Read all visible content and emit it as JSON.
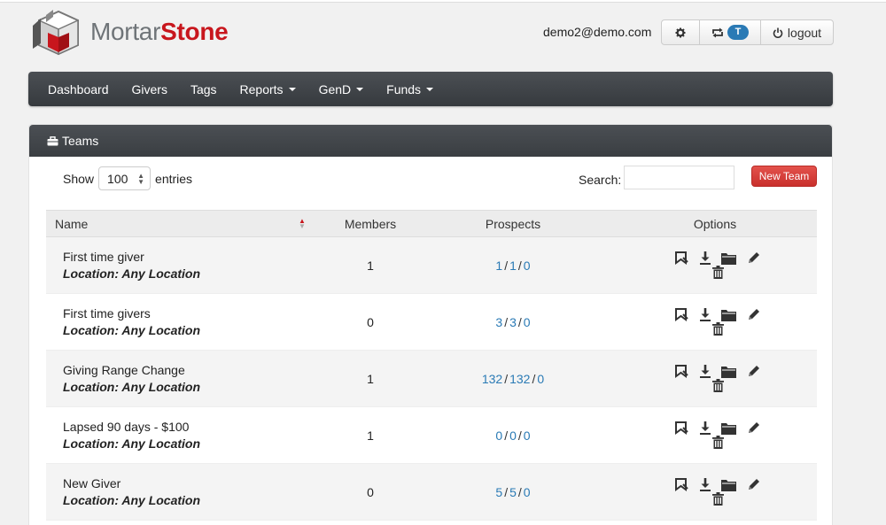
{
  "brand": {
    "part1": "Mortar",
    "part2": "Stone"
  },
  "header": {
    "user_email": "demo2@demo.com",
    "settings_icon": "gear-icon",
    "retweet_icon": "repeat-icon",
    "badge": "T",
    "logout_label": "logout"
  },
  "nav": {
    "items": [
      {
        "label": "Dashboard",
        "dropdown": false
      },
      {
        "label": "Givers",
        "dropdown": false
      },
      {
        "label": "Tags",
        "dropdown": false
      },
      {
        "label": "Reports",
        "dropdown": true
      },
      {
        "label": "GenD",
        "dropdown": true
      },
      {
        "label": "Funds",
        "dropdown": true
      }
    ]
  },
  "panel": {
    "title": "Teams",
    "show_label": "Show",
    "entries_value": "100",
    "entries_label": "entries",
    "search_label": "Search:",
    "search_value": "",
    "new_team_label": "New Team"
  },
  "table": {
    "headers": {
      "name": "Name",
      "members": "Members",
      "prospects": "Prospects",
      "options": "Options"
    },
    "rows": [
      {
        "name": "First time giver",
        "location": "Location: Any Location",
        "members": "1",
        "p1": "1",
        "p2": "1",
        "p3": "0"
      },
      {
        "name": "First time givers",
        "location": "Location: Any Location",
        "members": "0",
        "p1": "3",
        "p2": "3",
        "p3": "0"
      },
      {
        "name": "Giving Range Change",
        "location": "Location: Any Location",
        "members": "1",
        "p1": "132",
        "p2": "132",
        "p3": "0"
      },
      {
        "name": "Lapsed 90 days - $100",
        "location": "Location: Any Location",
        "members": "1",
        "p1": "0",
        "p2": "0",
        "p3": "0"
      },
      {
        "name": "New Giver",
        "location": "Location: Any Location",
        "members": "0",
        "p1": "5",
        "p2": "5",
        "p3": "0"
      }
    ]
  },
  "colors": {
    "brand_red": "#c8161d",
    "nav_dark": "#3f4347",
    "link_blue": "#2a7ab5",
    "badge_blue": "#2a7ab5",
    "danger": "#d9534f"
  }
}
